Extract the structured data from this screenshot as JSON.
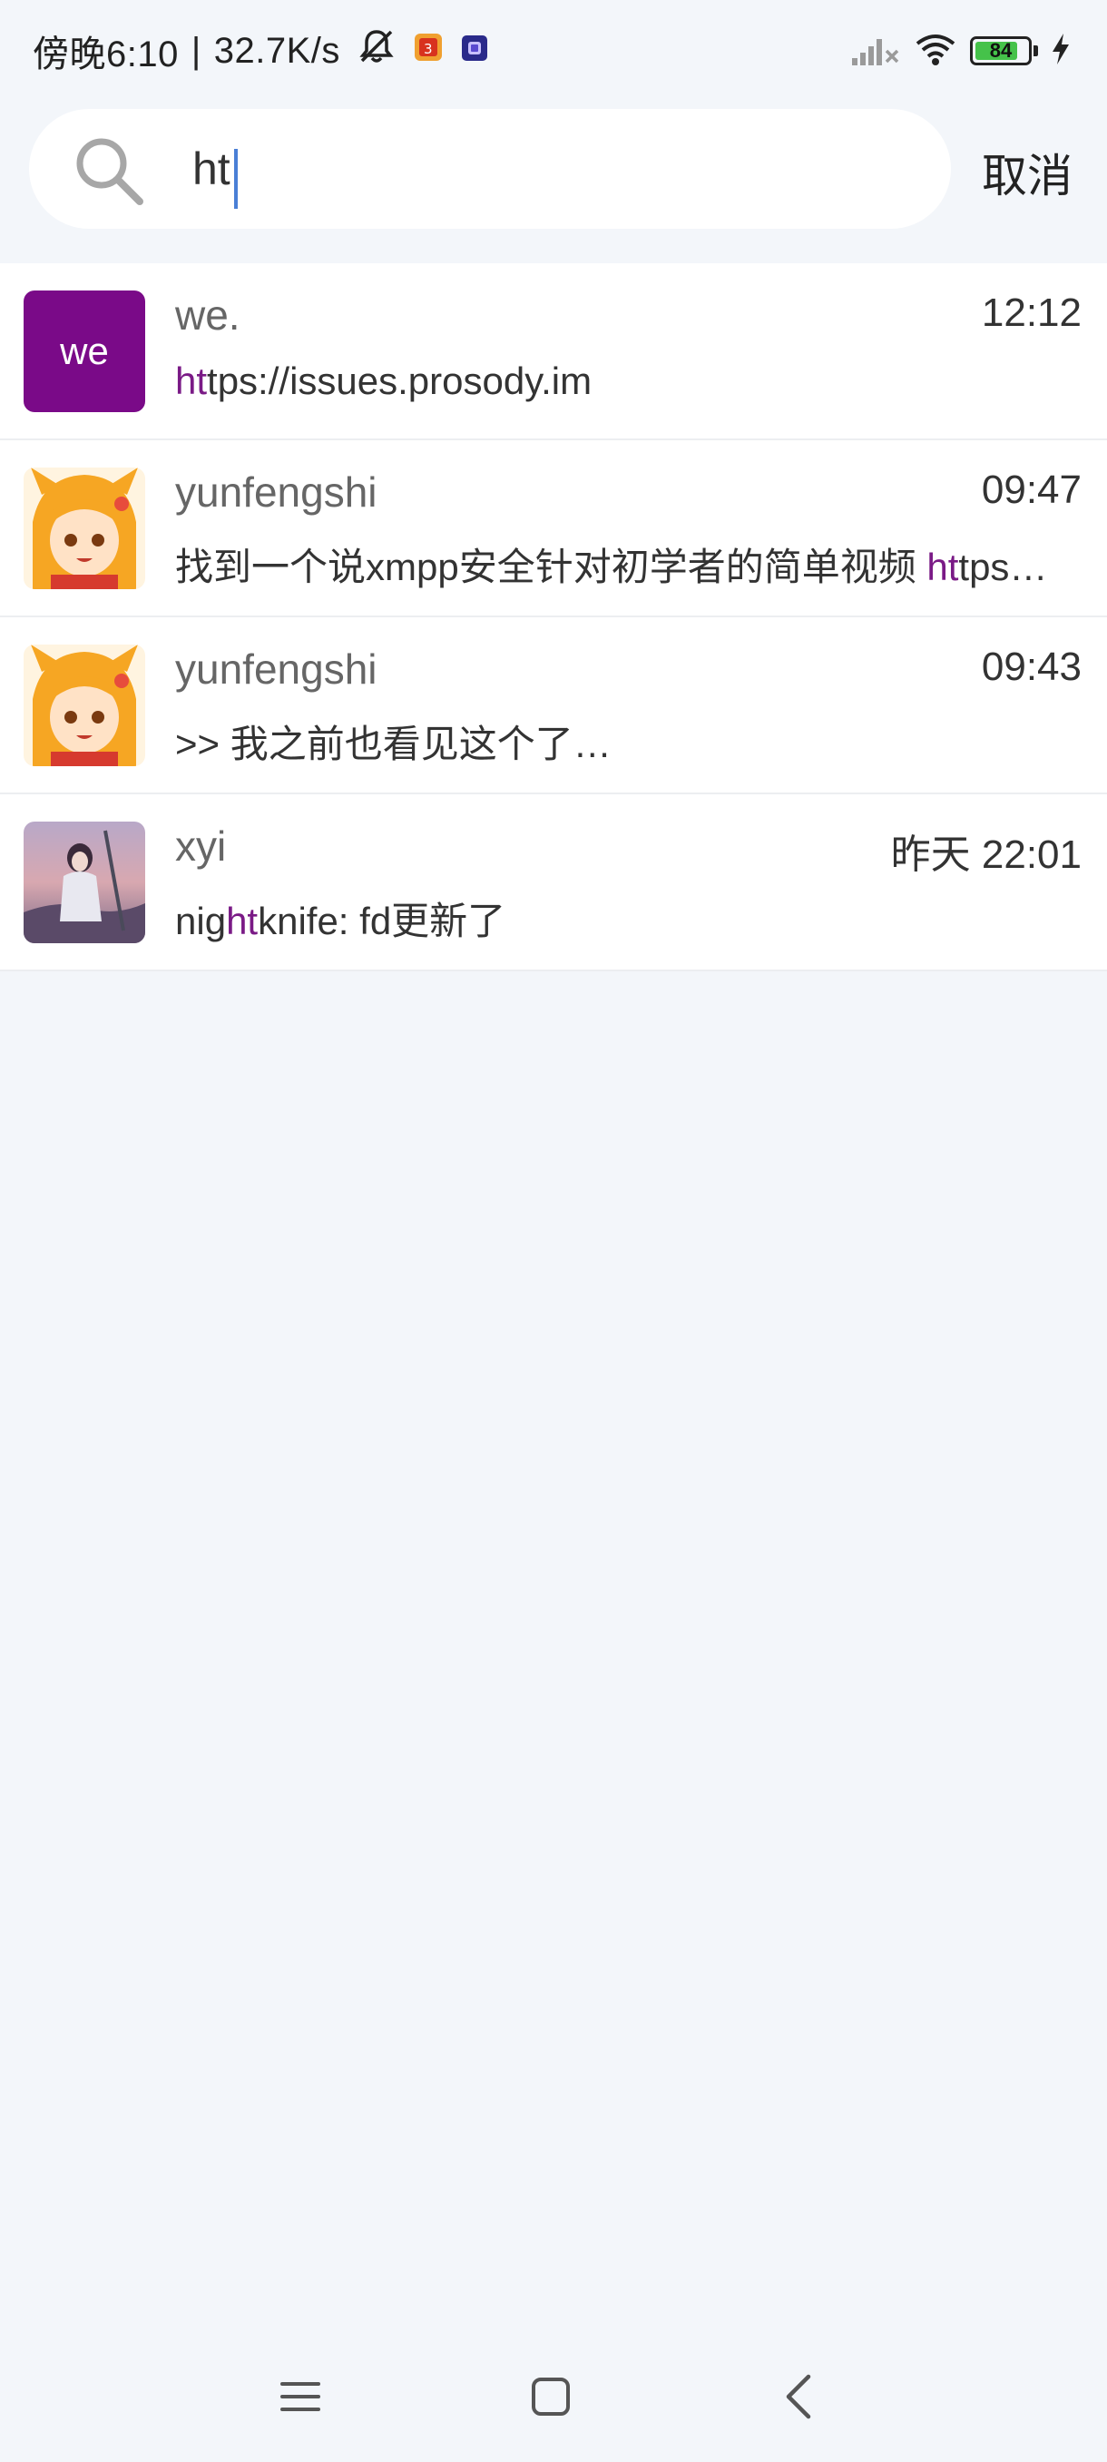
{
  "status_bar": {
    "time": "傍晚6:10",
    "separator": "|",
    "net_speed": "32.7K/s",
    "battery": "84",
    "battery_level": 0.84,
    "icons": [
      "bell-muted-icon",
      "app-badge-icon",
      "app-badge-icon",
      "cellular-signal-icon",
      "wifi-icon",
      "battery-icon",
      "charging-icon"
    ]
  },
  "search": {
    "query": "ht",
    "cancel_label": "取消",
    "icon": "search-icon"
  },
  "results": [
    {
      "name": "we.",
      "time": "12:12",
      "avatar_text": "we",
      "avatar_color": "#7a0a88",
      "preview_pre": "",
      "preview_hl": "ht",
      "preview_post": "tps://issues.prosody.im"
    },
    {
      "name": "yunfengshi",
      "time": "09:47",
      "avatar_text": "",
      "avatar_color": "#f6a623",
      "preview_pre": "找到一个说xmpp安全针对初学者的简单视频 ",
      "preview_hl": "ht",
      "preview_post": "tps…"
    },
    {
      "name": "yunfengshi",
      "time": "09:43",
      "avatar_text": "",
      "avatar_color": "#f6a623",
      "preview_pre": ">> 我之前也看见这个了…",
      "preview_hl": "",
      "preview_post": ""
    },
    {
      "name": "xyi",
      "time": "昨天 22:01",
      "avatar_text": "",
      "avatar_color": "#8a7a9a",
      "preview_pre": "nig",
      "preview_hl": "ht",
      "preview_post": "knife: fd更新了"
    }
  ],
  "colors": {
    "background": "#f3f6fa",
    "highlight": "#7a1a86",
    "caret": "#4a7fd6"
  },
  "nav_bar": {
    "icons": [
      "menu-icon",
      "home-icon",
      "back-icon"
    ]
  }
}
